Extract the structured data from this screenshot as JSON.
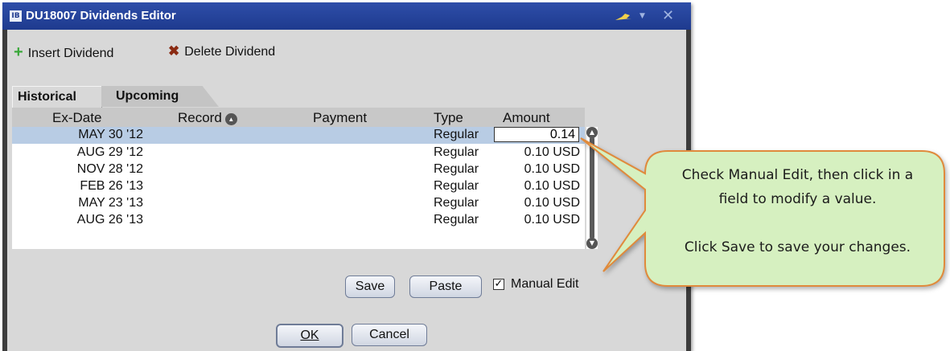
{
  "window": {
    "title": "DU18007 Dividends Editor",
    "logo": "IB"
  },
  "toolbar": {
    "insert_label": "Insert Dividend",
    "delete_label": "Delete Dividend"
  },
  "tabs": [
    {
      "label": "Historical",
      "active": true
    },
    {
      "label": "Upcoming",
      "active": false
    }
  ],
  "table": {
    "columns": [
      "Ex-Date",
      "Record",
      "Payment",
      "Type",
      "Amount"
    ],
    "rows": [
      {
        "ex_date": "MAY 30 '12",
        "type": "Regular",
        "amount": "0.14",
        "selected": true,
        "editing": true
      },
      {
        "ex_date": "AUG 29 '12",
        "type": "Regular",
        "amount": "0.10 USD"
      },
      {
        "ex_date": "NOV 28 '12",
        "type": "Regular",
        "amount": "0.10 USD"
      },
      {
        "ex_date": "FEB 26 '13",
        "type": "Regular",
        "amount": "0.10 USD"
      },
      {
        "ex_date": "MAY 23 '13",
        "type": "Regular",
        "amount": "0.10 USD"
      },
      {
        "ex_date": "AUG 26 '13",
        "type": "Regular",
        "amount": "0.10 USD"
      }
    ]
  },
  "actions": {
    "save": "Save",
    "paste": "Paste",
    "manual_edit": "Manual Edit",
    "manual_edit_checked": true
  },
  "dialog": {
    "ok": "OK",
    "cancel": "Cancel"
  },
  "callout": {
    "line1": "Check Manual Edit, then click in a",
    "line2": "field to modify a value.",
    "line3": "Click Save to save your changes."
  },
  "colors": {
    "title_bar": "#1e3a8e",
    "selection": "#b8cce4",
    "callout_fill": "#d6f0c0",
    "callout_border": "#e08a3c"
  }
}
